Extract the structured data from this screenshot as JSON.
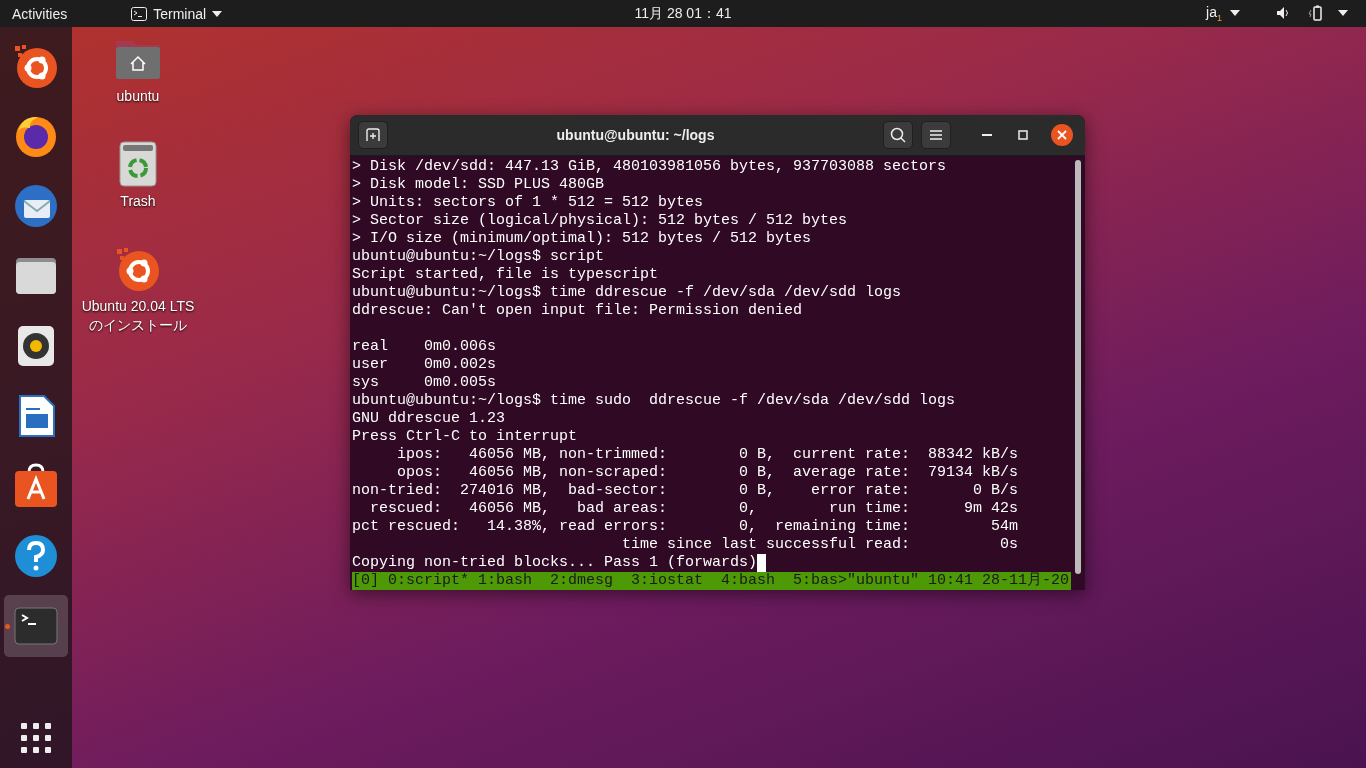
{
  "top_bar": {
    "activities": "Activities",
    "app_menu": "Terminal",
    "clock": "11月 28 01：41",
    "input_method": "ja$_{1}$"
  },
  "dock": {
    "items": [
      {
        "kind": "installer",
        "running": false,
        "focused": false
      },
      {
        "kind": "browser",
        "running": false,
        "focused": false
      },
      {
        "kind": "mail",
        "running": false,
        "focused": false
      },
      {
        "kind": "files",
        "running": false,
        "focused": false
      },
      {
        "kind": "music",
        "running": false,
        "focused": false
      },
      {
        "kind": "writer",
        "running": false,
        "focused": false
      },
      {
        "kind": "software",
        "running": false,
        "focused": false
      },
      {
        "kind": "help",
        "running": false,
        "focused": false
      },
      {
        "kind": "terminal",
        "running": true,
        "focused": true
      }
    ]
  },
  "desktop_icons": [
    {
      "kind": "home",
      "label": "ubuntu"
    },
    {
      "kind": "trash",
      "label": "Trash"
    },
    {
      "kind": "installer",
      "label": "Ubuntu 20.04 LTS のインストール"
    }
  ],
  "terminal": {
    "title": "ubuntu@ubuntu: ~/logs",
    "blocks": [
      {
        "lines": [
          {
            "text": "> Disk /dev/sdd: 447.13 GiB, 480103981056 bytes, 937703088 sectors"
          },
          {
            "text": "> Disk model: SSD PLUS 480GB"
          },
          {
            "text": "> Units: sectors of 1 * 512 = 512 bytes"
          },
          {
            "text": "> Sector size (logical/physical): 512 bytes / 512 bytes"
          },
          {
            "text": "> I/O size (minimum/optimal): 512 bytes / 512 bytes"
          },
          {
            "text": "ubuntu@ubuntu:~/logs$ script"
          },
          {
            "text": "Script started, file is typescript"
          },
          {
            "text": "ubuntu@ubuntu:~/logs$ time ddrescue -f /dev/sda /dev/sdd logs"
          },
          {
            "text": "ddrescue: Can't open input file: Permission denied"
          }
        ]
      },
      {
        "lines": [
          {
            "text": "real    0m0.006s"
          },
          {
            "text": "user    0m0.002s"
          },
          {
            "text": "sys     0m0.005s"
          },
          {
            "text": "ubuntu@ubuntu:~/logs$ time sudo  ddrescue -f /dev/sda /dev/sdd logs"
          },
          {
            "text": "GNU ddrescue 1.23"
          },
          {
            "text": "Press Ctrl-C to interrupt"
          },
          {
            "text": "     ipos:   46056 MB, non-trimmed:        0 B,  current rate:  88342 kB/s"
          },
          {
            "text": "     opos:   46056 MB, non-scraped:        0 B,  average rate:  79134 kB/s"
          },
          {
            "text": "non-tried:  274016 MB,  bad-sector:        0 B,    error rate:       0 B/s"
          },
          {
            "text": "  rescued:   46056 MB,   bad areas:        0,        run time:      9m 42s"
          },
          {
            "text": "pct rescued:   14.38%, read errors:        0,  remaining time:         54m"
          },
          {
            "text": "                              time since last successful read:          0s"
          },
          {
            "text": "Copying non-tried blocks... Pass 1 (forwards)",
            "cursor": true
          }
        ]
      }
    ],
    "status_bar": "[0] 0:script* 1:bash  2:dmesg  3:iostat  4:bash  5:bas>\"ubuntu\" 10:41 28-11月-20"
  }
}
